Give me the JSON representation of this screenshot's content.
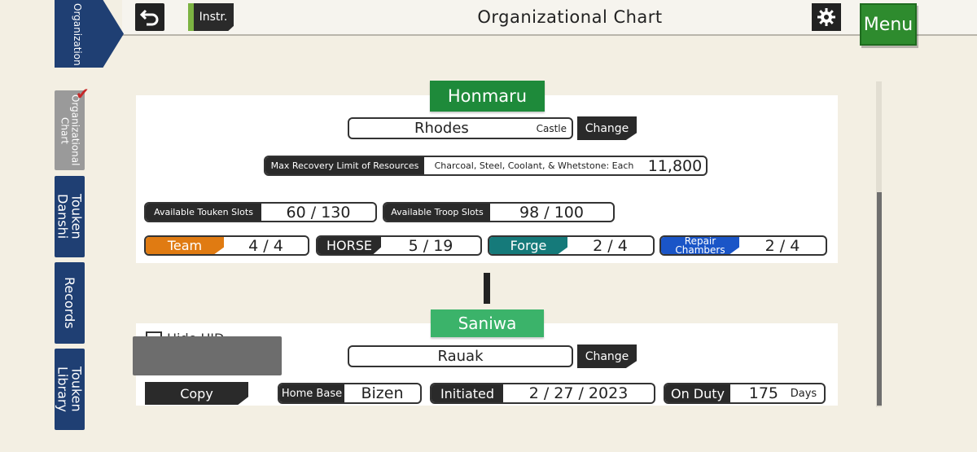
{
  "header": {
    "title": "Organizational Chart",
    "instr_label": "Instr.",
    "menu_label": "Menu"
  },
  "sidebar": {
    "organization_tab": "Organization",
    "tabs": [
      {
        "label": "Organizational Chart",
        "active": true
      },
      {
        "label": "Touken Danshi"
      },
      {
        "label": "Records"
      },
      {
        "label": "Touken Library"
      }
    ]
  },
  "honmaru": {
    "title": "Honmaru",
    "castle_name": "Rhodes",
    "castle_suffix": "Castle",
    "change_label": "Change",
    "resources_label": "Max Recovery Limit of Resources",
    "resources_desc": "Charcoal, Steel, Coolant, & Whetstone: Each",
    "resources_value": "11,800",
    "touken_slots_label": "Available Touken Slots",
    "touken_slots_value": "60  /  130",
    "troop_slots_label": "Available Troop Slots",
    "troop_slots_value": "98  /  100",
    "team_label": "Team",
    "team_value": "4  /  4",
    "horse_label": "HORSE",
    "horse_value": "5  / 19",
    "forge_label": "Forge",
    "forge_value": "2  /  4",
    "repair_label": "Repair Chambers",
    "repair_value": "2  /  4"
  },
  "saniwa": {
    "title": "Saniwa",
    "hide_label": "Hide UID",
    "name": "Rauak",
    "change_label": "Change",
    "copy_label": "Copy",
    "home_base_label": "Home Base",
    "home_base_value": "Bizen",
    "initiated_label": "Initiated",
    "initiated_value": "2  / 27 / 2023",
    "on_duty_label": "On Duty",
    "on_duty_value": "175",
    "on_duty_unit": "Days"
  },
  "colors": {
    "team": "#e07b12",
    "forge": "#157a7a",
    "repair": "#1a55c7",
    "honmaru_green": "#1e8a3a",
    "saniwa_green": "#3bb36a",
    "nav_blue": "#1f3f73"
  },
  "icons": {
    "back": "back-arrow-icon",
    "settings": "gear-icon",
    "check": "checkmark-icon"
  }
}
